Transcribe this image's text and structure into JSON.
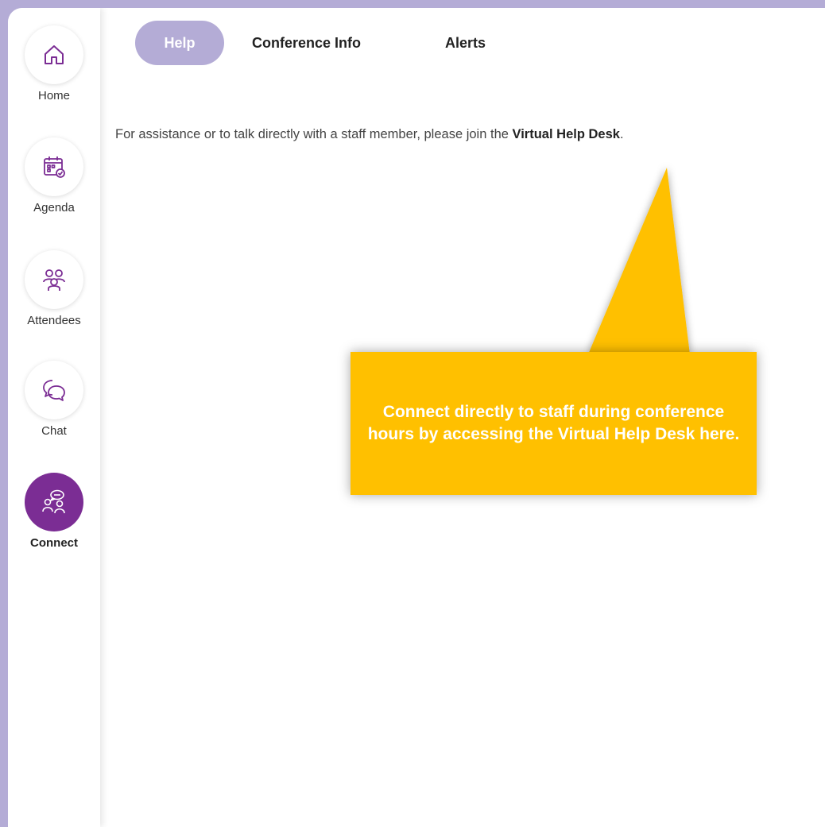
{
  "sidebar": {
    "items": [
      {
        "label": "Home",
        "icon": "home-icon"
      },
      {
        "label": "Agenda",
        "icon": "calendar-icon"
      },
      {
        "label": "Attendees",
        "icon": "people-icon"
      },
      {
        "label": "Chat",
        "icon": "chat-icon"
      },
      {
        "label": "Connect",
        "icon": "connect-icon",
        "active": true
      }
    ]
  },
  "tabs": [
    {
      "label": "Help",
      "active": true
    },
    {
      "label": "Conference Info"
    },
    {
      "label": "Alerts"
    }
  ],
  "main": {
    "help_text": "For assistance or to talk directly with a staff member, please join the ",
    "help_link": "Virtual Help Desk",
    "help_text_end": "."
  },
  "callout": {
    "text": "Connect directly to staff during conference hours by accessing the Virtual Help Desk here."
  },
  "colors": {
    "frame": "#b4acd6",
    "accent": "#7b2d94",
    "callout": "#ffc000"
  }
}
